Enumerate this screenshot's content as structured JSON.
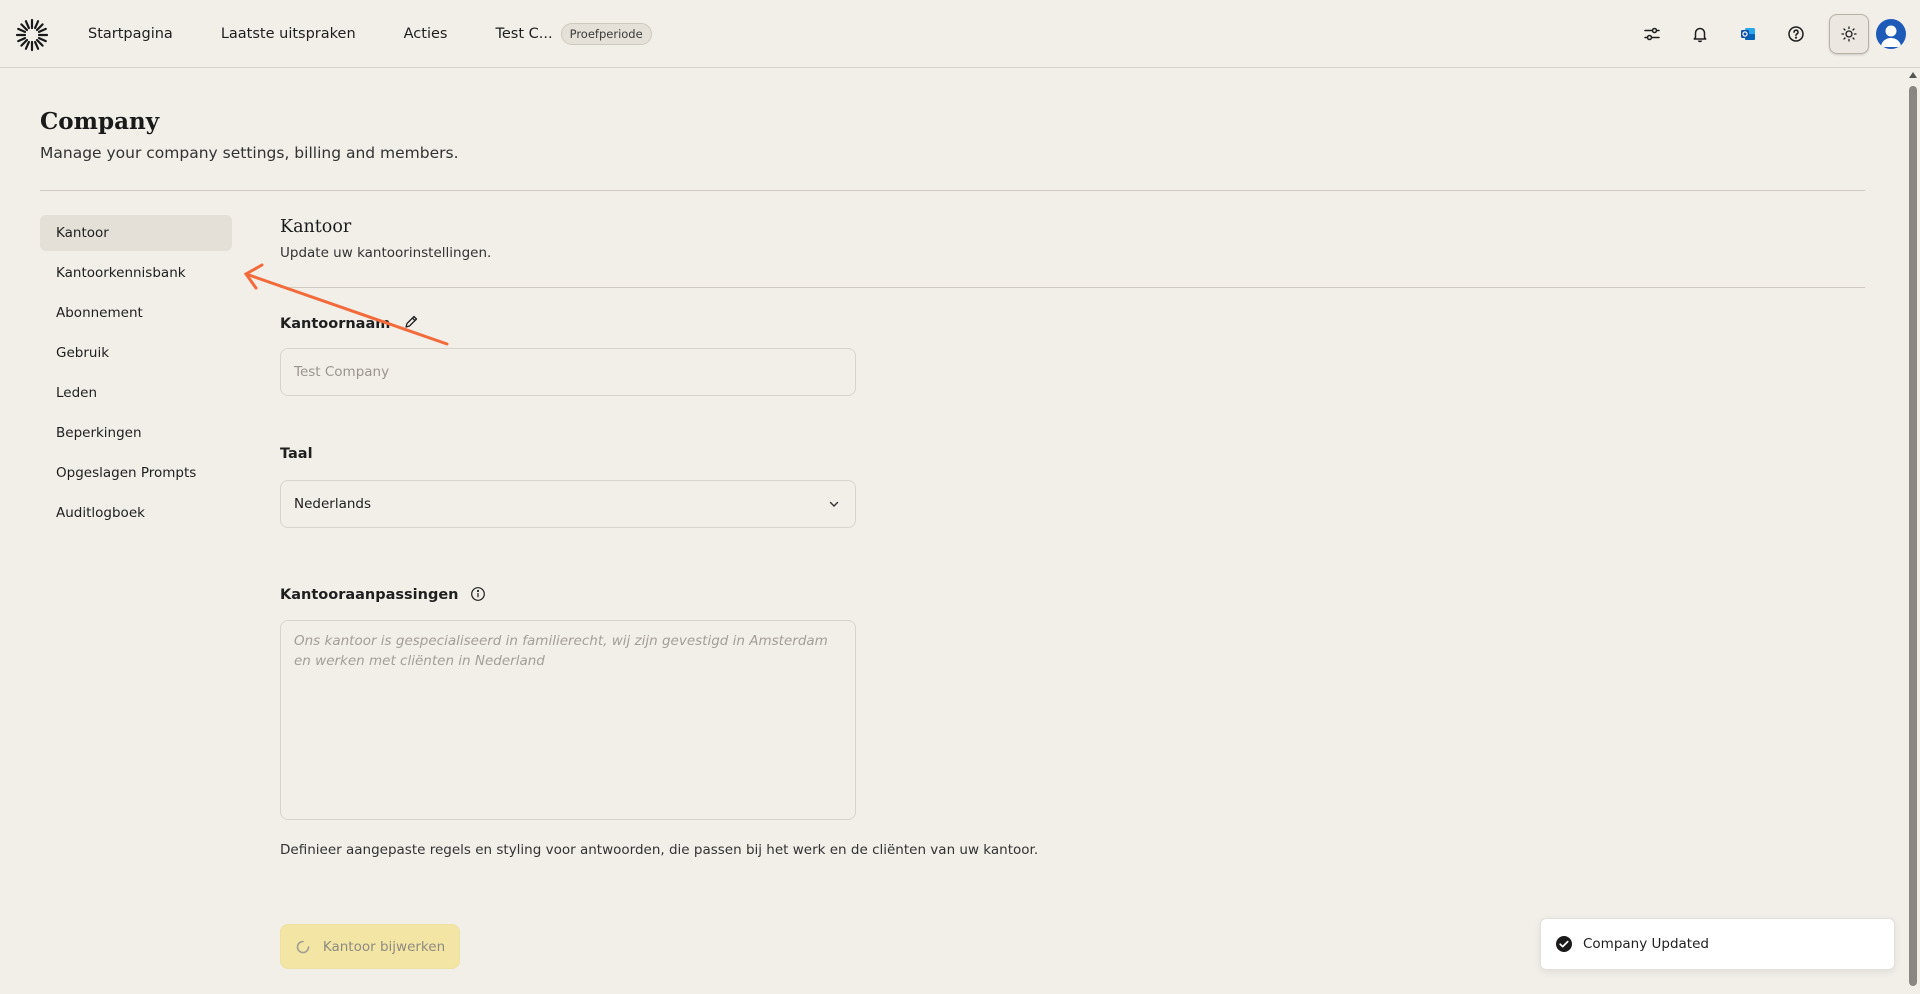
{
  "topbar": {
    "nav": [
      "Startpagina",
      "Laatste uitspraken",
      "Acties"
    ],
    "company_name": "Test C...",
    "trial_badge": "Proefperiode",
    "icons": [
      "sliders-icon",
      "bell-icon",
      "outlook-icon",
      "help-icon",
      "sun-icon",
      "user-avatar"
    ]
  },
  "page": {
    "title": "Company",
    "subtitle": "Manage your company settings, billing and members."
  },
  "sidebar": {
    "items": [
      {
        "label": "Kantoor",
        "active": true
      },
      {
        "label": "Kantoorkennisbank"
      },
      {
        "label": "Abonnement"
      },
      {
        "label": "Gebruik"
      },
      {
        "label": "Leden"
      },
      {
        "label": "Beperkingen"
      },
      {
        "label": "Opgeslagen Prompts"
      },
      {
        "label": "Auditlogboek"
      }
    ]
  },
  "section": {
    "title": "Kantoor",
    "subtitle": "Update uw kantoorinstellingen."
  },
  "form": {
    "name_label": "Kantoornaam",
    "name_value": "Test Company",
    "language_label": "Taal",
    "language_value": "Nederlands",
    "custom_label": "Kantooraanpassingen",
    "custom_placeholder": "Ons kantoor is gespecialiseerd in familierecht, wij zijn gevestigd in Amsterdam en werken met cliënten in Nederland",
    "custom_help": "Definieer aangepaste regels en styling voor antwoorden, die passen bij het werk en de cliënten van uw kantoor.",
    "submit_label": "Kantoor bijwerken"
  },
  "toast": {
    "message": "Company Updated"
  },
  "colors": {
    "background": "#f2efe9",
    "accent_button": "#f3e6a5",
    "annotation_arrow": "#f26b3a"
  }
}
